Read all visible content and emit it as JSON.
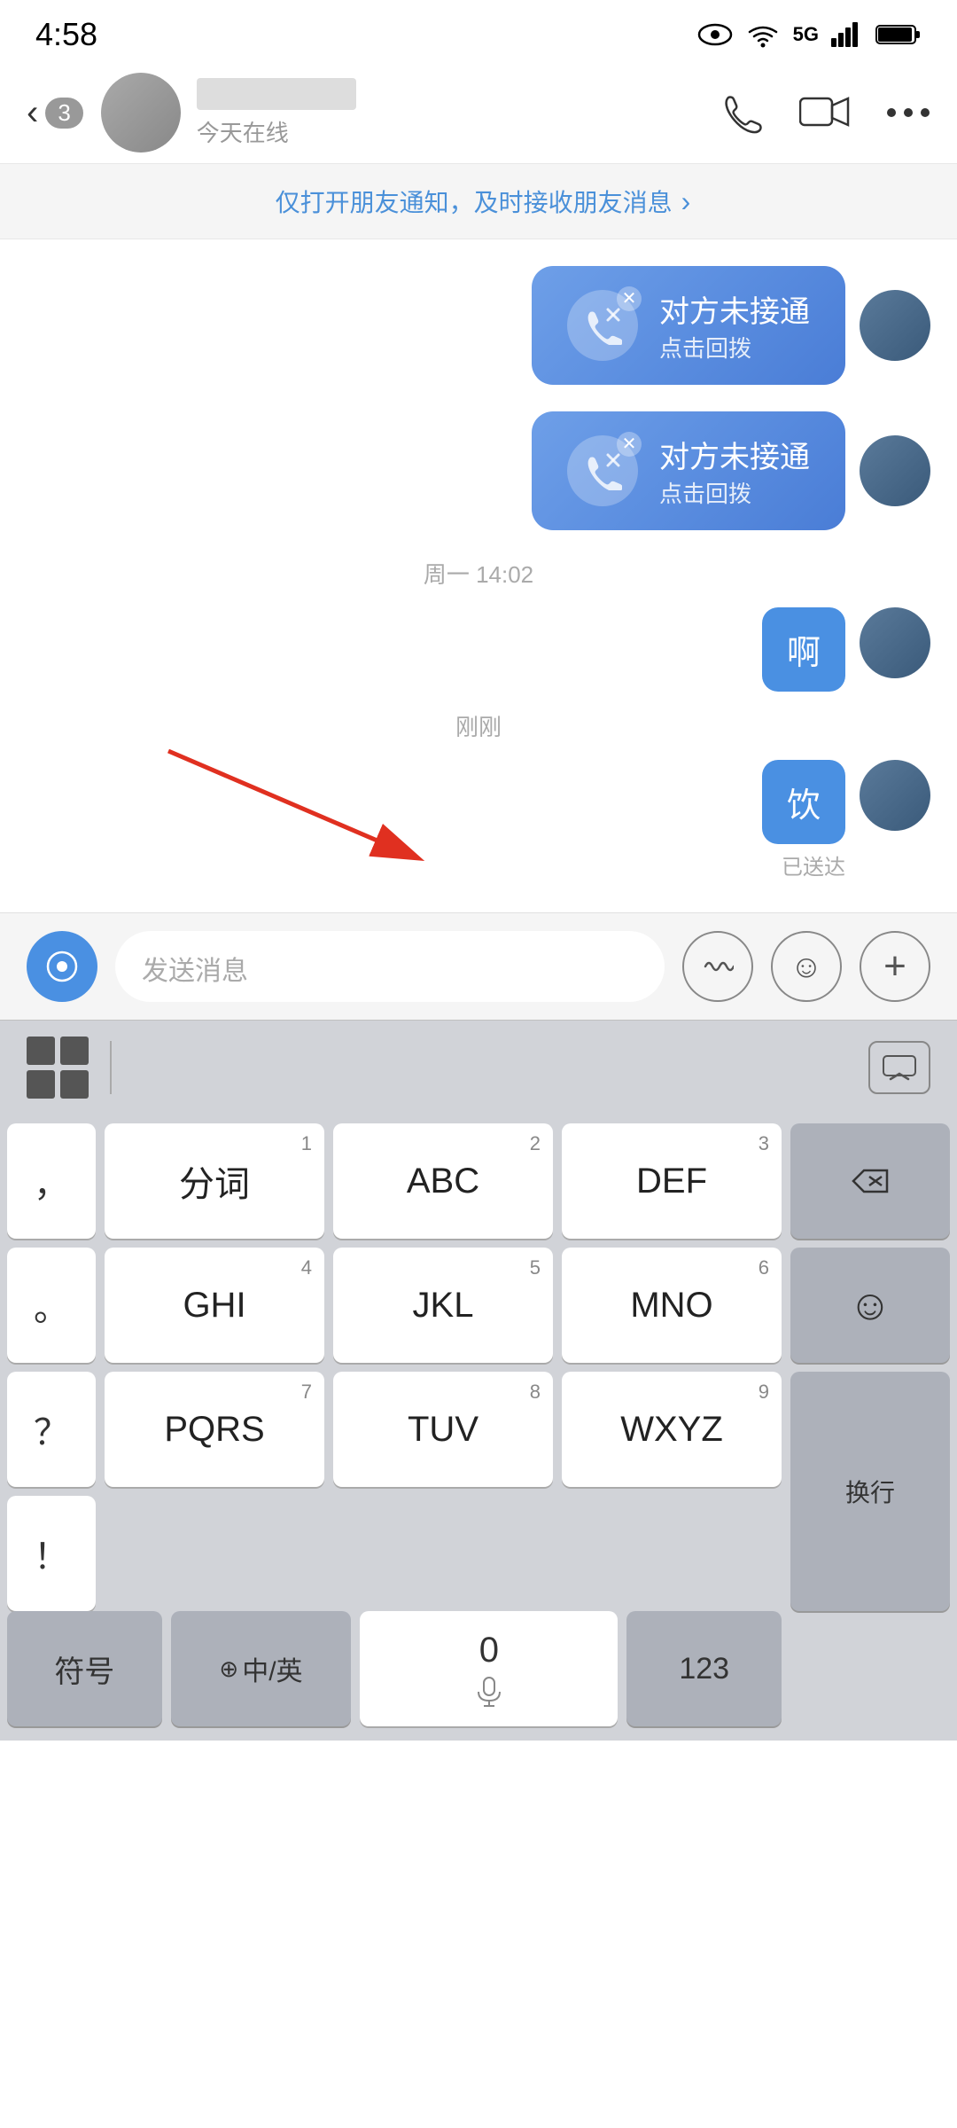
{
  "statusBar": {
    "time": "4:58"
  },
  "header": {
    "backLabel": "3",
    "contactStatus": "今天在线",
    "actionPhone": "phone",
    "actionVideo": "video",
    "actionMore": "more"
  },
  "notificationBanner": {
    "text": "仅打开朋友通知，及时接收朋友消息",
    "arrow": "›"
  },
  "chat": {
    "missedCalls": [
      {
        "mainText": "对方未接通",
        "subText": "点击回拨"
      },
      {
        "mainText": "对方未接通",
        "subText": "点击回拨"
      }
    ],
    "timestamp1": "周一 14:02",
    "msg1": {
      "text": "啊",
      "sent": true
    },
    "timestamp2": "刚刚",
    "msg2": {
      "text": "饮",
      "sent": true,
      "deliveredLabel": "已送达"
    }
  },
  "inputBar": {
    "placeholder": "发送消息",
    "voiceBtn": "voice",
    "soundBtn": "sound-wave",
    "emojiBtn": "emoji",
    "addBtn": "add"
  },
  "keyboard": {
    "toolbarApps": "apps",
    "hideBtn": "chevron-down",
    "rows": [
      {
        "keys": [
          {
            "label": "，",
            "number": "",
            "type": "single"
          },
          {
            "label": "分词",
            "number": "1",
            "type": "main"
          },
          {
            "label": "ABC",
            "number": "2",
            "type": "main"
          },
          {
            "label": "DEF",
            "number": "3",
            "type": "main"
          }
        ],
        "rightKey": {
          "label": "⌫",
          "type": "backspace"
        }
      },
      {
        "keys": [
          {
            "label": "。",
            "number": "",
            "type": "single"
          },
          {
            "label": "GHI",
            "number": "4",
            "type": "main"
          },
          {
            "label": "JKL",
            "number": "5",
            "type": "main"
          },
          {
            "label": "MNO",
            "number": "6",
            "type": "main"
          }
        ],
        "rightKey": {
          "label": "☺",
          "type": "emoji"
        }
      },
      {
        "keys": [
          {
            "label": "？",
            "number": "",
            "type": "single"
          },
          {
            "label": "PQRS",
            "number": "7",
            "type": "main"
          },
          {
            "label": "TUV",
            "number": "8",
            "type": "main"
          },
          {
            "label": "WXYZ",
            "number": "9",
            "type": "main"
          }
        ],
        "rightKey": {
          "label": "",
          "type": "spacer"
        }
      },
      {
        "keys": [
          {
            "label": "！",
            "number": "",
            "type": "single"
          },
          {
            "label": "",
            "number": "",
            "type": "spacer"
          },
          {
            "label": "",
            "number": "",
            "type": "spacer"
          },
          {
            "label": "",
            "number": "",
            "type": "spacer"
          }
        ],
        "rightKey": {
          "label": "换行",
          "type": "newline"
        }
      }
    ],
    "bottomRow": [
      {
        "label": "符号",
        "type": "dark"
      },
      {
        "label": "中/英",
        "number": "⊕",
        "type": "dark"
      },
      {
        "label": "0",
        "number": "🎤",
        "type": "light-space"
      },
      {
        "label": "123",
        "type": "dark"
      }
    ]
  }
}
